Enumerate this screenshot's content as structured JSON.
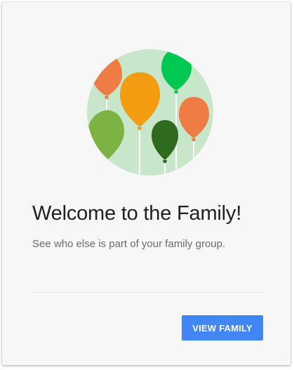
{
  "card": {
    "title": "Welcome to the Family!",
    "subtitle": "See who else is part of your family group.",
    "button_label": "VIEW FAMILY"
  },
  "illustration": {
    "icon": "balloons-illustration",
    "colors": {
      "circle": "#c8e6c9",
      "balloon_orange": "#f07c45",
      "balloon_amber": "#f39c12",
      "balloon_green": "#00c853",
      "balloon_light_green": "#7cb342",
      "balloon_dark_green": "#2e6b1f"
    }
  },
  "colors": {
    "accent": "#4285f4",
    "card_background": "#f7f7f7",
    "title_text": "#212121",
    "body_text": "#6a6a6a"
  }
}
